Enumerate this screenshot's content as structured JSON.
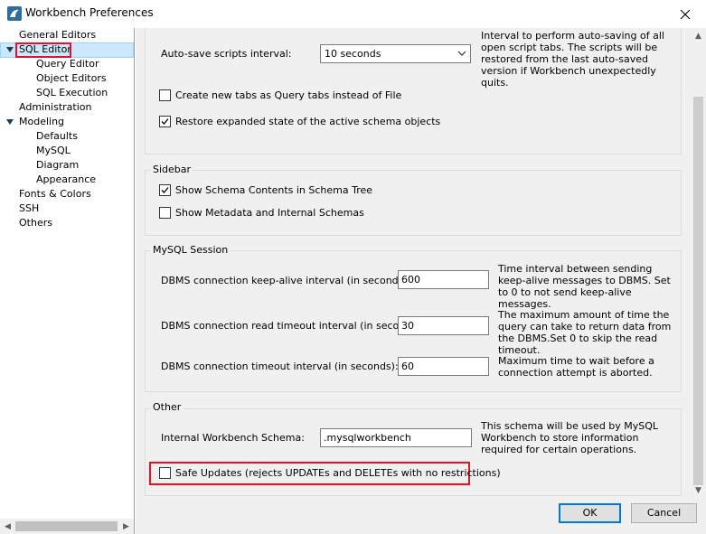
{
  "window": {
    "title": "Workbench Preferences"
  },
  "sidebar": {
    "items": [
      {
        "label": "General Editors"
      },
      {
        "label": "SQL Editor"
      },
      {
        "label": "Query Editor"
      },
      {
        "label": "Object Editors"
      },
      {
        "label": "SQL Execution"
      },
      {
        "label": "Administration"
      },
      {
        "label": "Modeling"
      },
      {
        "label": "Defaults"
      },
      {
        "label": "MySQL"
      },
      {
        "label": "Diagram"
      },
      {
        "label": "Appearance"
      },
      {
        "label": "Fonts & Colors"
      },
      {
        "label": "SSH"
      },
      {
        "label": "Others"
      }
    ]
  },
  "top_section": {
    "autosave_label": "Auto-save scripts interval:",
    "autosave_value": "10 seconds",
    "autosave_desc": "Interval to perform auto-saving of all open script tabs. The scripts will be restored from the last auto-saved version if Workbench unexpectedly quits.",
    "new_tabs_label": "Create new tabs as Query tabs instead of File",
    "new_tabs_checked": false,
    "restore_label": "Restore expanded state of the active schema objects",
    "restore_checked": true
  },
  "sidebar_group": {
    "title": "Sidebar",
    "show_contents_label": "Show Schema Contents in Schema Tree",
    "show_contents_checked": true,
    "show_metadata_label": "Show Metadata and Internal Schemas",
    "show_metadata_checked": false
  },
  "session_group": {
    "title": "MySQL Session",
    "keepalive_label": "DBMS connection keep-alive interval (in seconds):",
    "keepalive_value": "600",
    "keepalive_desc": "Time interval between sending keep-alive messages to DBMS. Set to 0 to not send keep-alive messages.",
    "read_timeout_label": "DBMS connection read timeout interval (in seconds):",
    "read_timeout_value": "30",
    "read_timeout_desc": "The maximum amount of time the query can take to return data from the DBMS.Set 0 to skip the read timeout.",
    "conn_timeout_label": "DBMS connection timeout interval (in seconds):",
    "conn_timeout_value": "60",
    "conn_timeout_desc": "Maximum time to wait before a connection attempt is aborted."
  },
  "other_group": {
    "title": "Other",
    "schema_label": "Internal Workbench Schema:",
    "schema_value": ".mysqlworkbench",
    "schema_desc": "This schema will be used by MySQL Workbench to store information required for certain operations.",
    "safe_updates_label": "Safe Updates (rejects UPDATEs and DELETEs with no restrictions)",
    "safe_updates_checked": false
  },
  "buttons": {
    "ok": "OK",
    "cancel": "Cancel"
  },
  "colors": {
    "highlight": "#e81123",
    "selection": "#cce8ff",
    "accent": "#0078d7"
  }
}
